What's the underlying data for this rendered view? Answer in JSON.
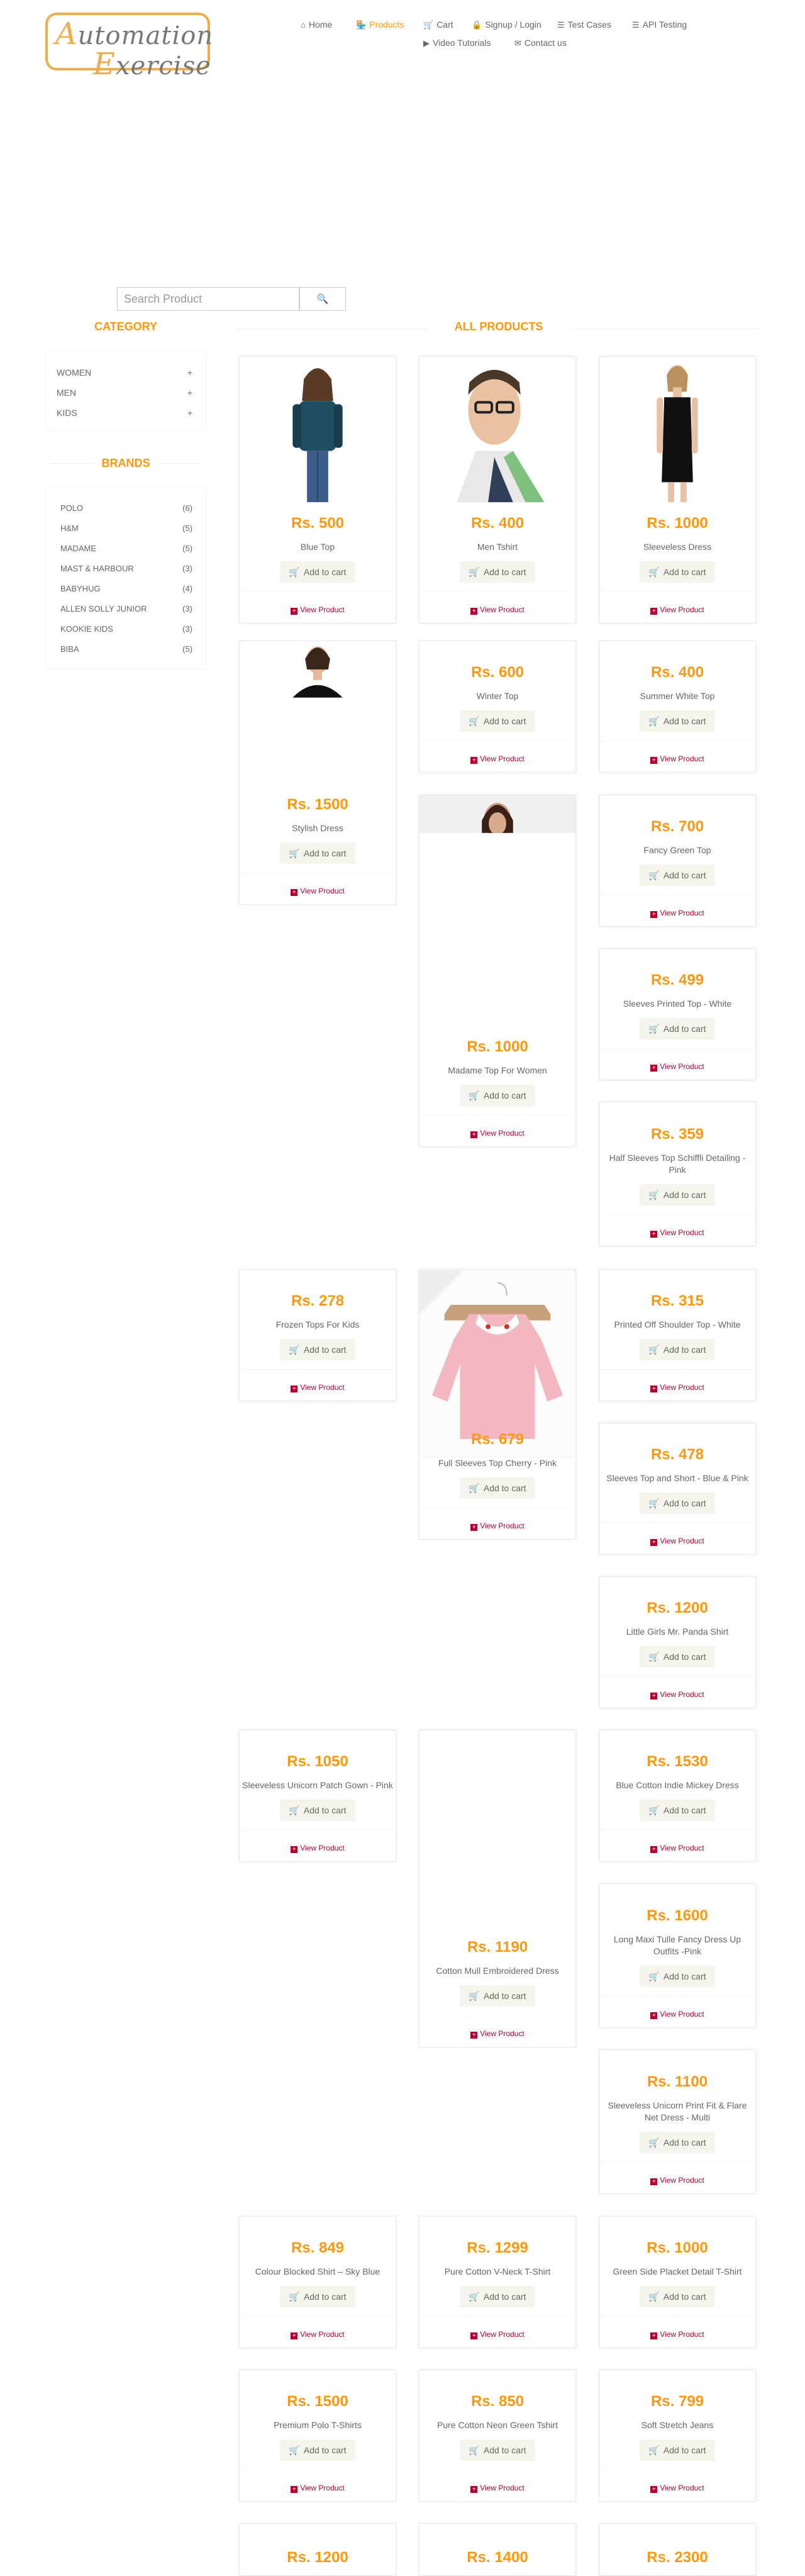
{
  "logo": {
    "line1_cap": "A",
    "line1_rest": "utomation",
    "line2_cap": "E",
    "line2_rest": "xercise"
  },
  "nav": [
    {
      "icon": "⌂",
      "label": "Home"
    },
    {
      "icon": "🏪",
      "label": "Products"
    },
    {
      "icon": "🛒",
      "label": "Cart"
    },
    {
      "icon": "🔒",
      "label": "Signup / Login"
    },
    {
      "icon": "☰",
      "label": "Test Cases"
    },
    {
      "icon": "☰",
      "label": "API Testing"
    },
    {
      "icon": "▶",
      "label": "Video Tutorials"
    },
    {
      "icon": "✉",
      "label": "Contact us"
    }
  ],
  "search": {
    "placeholder": "Search Product",
    "button_icon": "🔍"
  },
  "category": {
    "title": "Category",
    "items": [
      {
        "label": "Women"
      },
      {
        "label": "Men"
      },
      {
        "label": "Kids"
      }
    ],
    "expand_icon": "+"
  },
  "brands": {
    "title": "Brands",
    "items": [
      {
        "label": "Polo",
        "count": "(6)"
      },
      {
        "label": "H&M",
        "count": "(5)"
      },
      {
        "label": "Madame",
        "count": "(5)"
      },
      {
        "label": "Mast & Harbour",
        "count": "(3)"
      },
      {
        "label": "Babyhug",
        "count": "(4)"
      },
      {
        "label": "Allen Solly Junior",
        "count": "(3)"
      },
      {
        "label": "Kookie Kids",
        "count": "(3)"
      },
      {
        "label": "Biba",
        "count": "(5)"
      }
    ]
  },
  "products_title": "All Products",
  "add_to_cart_label": "Add to cart",
  "view_product_label": "View Product",
  "products": [
    {
      "price": "Rs. 500",
      "name": "Blue Top"
    },
    {
      "price": "Rs. 400",
      "name": "Men Tshirt"
    },
    {
      "price": "Rs. 1000",
      "name": "Sleeveless Dress"
    },
    {
      "price": "Rs. 1500",
      "name": "Stylish Dress"
    },
    {
      "price": "Rs. 600",
      "name": "Winter Top"
    },
    {
      "price": "Rs. 400",
      "name": "Summer White Top"
    },
    {
      "price": "Rs. 1000",
      "name": "Madame Top For Women"
    },
    {
      "price": "Rs. 700",
      "name": "Fancy Green Top"
    },
    {
      "price": "Rs. 499",
      "name": "Sleeves Printed Top - White"
    },
    {
      "price": "Rs. 359",
      "name": "Half Sleeves Top Schiffli Detailing - Pink"
    },
    {
      "price": "Rs. 278",
      "name": "Frozen Tops For Kids"
    },
    {
      "price": "Rs. 679",
      "name": "Full Sleeves Top Cherry - Pink"
    },
    {
      "price": "Rs. 315",
      "name": "Printed Off Shoulder Top - White"
    },
    {
      "price": "Rs. 478",
      "name": "Sleeves Top and Short - Blue & Pink"
    },
    {
      "price": "Rs. 1200",
      "name": "Little Girls Mr. Panda Shirt"
    },
    {
      "price": "Rs. 1050",
      "name": "Sleeveless Unicorn Patch Gown - Pink"
    },
    {
      "price": "Rs. 1190",
      "name": "Cotton Mull Embroidered Dress"
    },
    {
      "price": "Rs. 1530",
      "name": "Blue Cotton Indie Mickey Dress"
    },
    {
      "price": "Rs. 1600",
      "name": "Long Maxi Tulle Fancy Dress Up Outfits -Pink"
    },
    {
      "price": "Rs. 1100",
      "name": "Sleeveless Unicorn Print Fit & Flare Net Dress - Multi"
    },
    {
      "price": "Rs. 849",
      "name": "Colour Blocked Shirt – Sky Blue"
    },
    {
      "price": "Rs. 1299",
      "name": "Pure Cotton V-Neck T-Shirt"
    },
    {
      "price": "Rs. 1000",
      "name": "Green Side Placket Detail T-Shirt"
    },
    {
      "price": "Rs. 1500",
      "name": "Premium Polo T-Shirts"
    },
    {
      "price": "Rs. 850",
      "name": "Pure Cotton Neon Green Tshirt"
    },
    {
      "price": "Rs. 799",
      "name": "Soft Stretch Jeans"
    },
    {
      "price": "Rs. 1200",
      "name": ""
    },
    {
      "price": "Rs. 1400",
      "name": ""
    },
    {
      "price": "Rs. 2300",
      "name": ""
    }
  ]
}
